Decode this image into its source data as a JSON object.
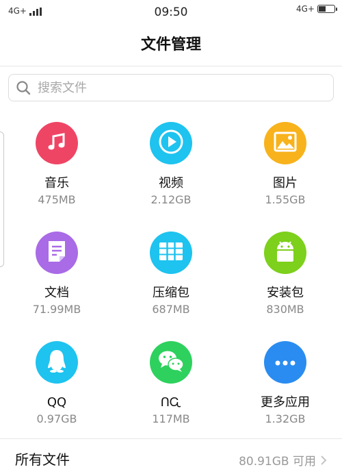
{
  "status_bar": {
    "left_network": "4G+",
    "time": "09:50",
    "right_network": "4G+",
    "battery_level": 0.4
  },
  "header": {
    "title": "文件管理"
  },
  "search": {
    "placeholder": "搜索文件"
  },
  "categories": [
    {
      "label": "音乐",
      "size": "475MB",
      "icon": "music-note-icon",
      "color": "#ef4565"
    },
    {
      "label": "视频",
      "size": "2.12GB",
      "icon": "play-icon",
      "color": "#1ec3ef"
    },
    {
      "label": "图片",
      "size": "1.55GB",
      "icon": "image-icon",
      "color": "#f8b21c"
    },
    {
      "label": "文档",
      "size": "71.99MB",
      "icon": "document-icon",
      "color": "#a96be6"
    },
    {
      "label": "压缩包",
      "size": "687MB",
      "icon": "archive-icon",
      "color": "#1ec3ef"
    },
    {
      "label": "安装包",
      "size": "830MB",
      "icon": "android-icon",
      "color": "#7dd01c"
    },
    {
      "label": "QQ",
      "size": "0.97GB",
      "icon": "qq-penguin-icon",
      "color": "#1ec3ef"
    },
    {
      "label": "ᑎᏩ",
      "size": "117MB",
      "icon": "wechat-icon",
      "color": "#2ed15e"
    },
    {
      "label": "更多应用",
      "size": "1.32GB",
      "icon": "more-icon",
      "color": "#2a8cf0"
    }
  ],
  "footer": {
    "label": "所有文件",
    "available": "80.91GB 可用"
  }
}
